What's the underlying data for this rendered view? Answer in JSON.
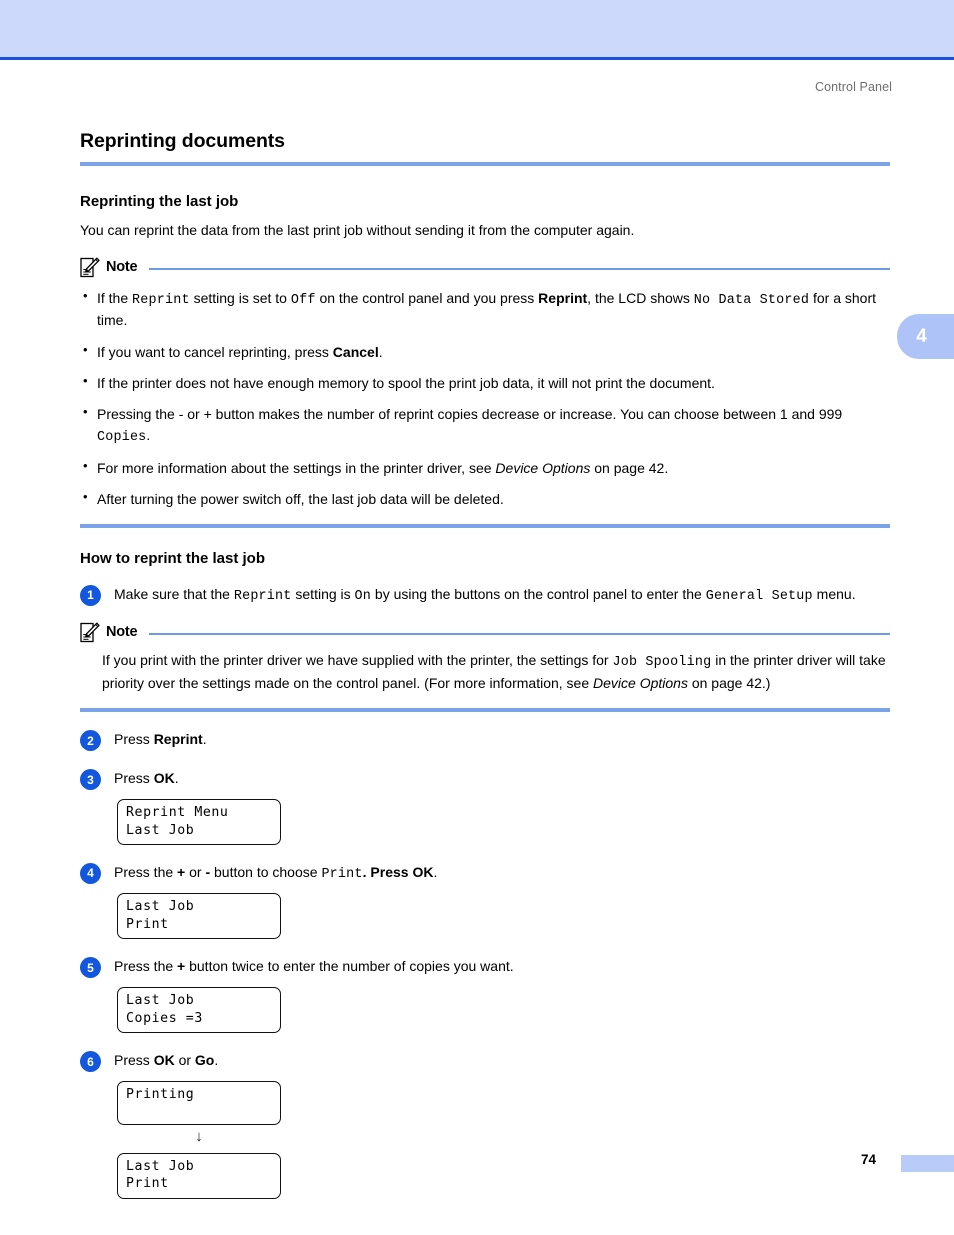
{
  "header": {
    "running_head": "Control Panel"
  },
  "chapter_tab": {
    "number": "4"
  },
  "section": {
    "title": "Reprinting documents"
  },
  "sub1": {
    "title": "Reprinting the last job",
    "intro": "You can reprint the data from the last print job without sending it from the computer again."
  },
  "note1": {
    "label": "Note",
    "icon": "note-pencil-icon",
    "bullets": [
      {
        "parts": [
          {
            "t": "If the ",
            "s": "plain"
          },
          {
            "t": "Reprint",
            "s": "mono"
          },
          {
            "t": " setting is set to ",
            "s": "plain"
          },
          {
            "t": "Off",
            "s": "mono"
          },
          {
            "t": " on the control panel and you press ",
            "s": "plain"
          },
          {
            "t": "Reprint",
            "s": "bold"
          },
          {
            "t": ", the LCD shows ",
            "s": "plain"
          },
          {
            "t": "No Data Stored",
            "s": "mono"
          },
          {
            "t": " for a short time.",
            "s": "plain"
          }
        ]
      },
      {
        "parts": [
          {
            "t": "If you want to cancel reprinting, press ",
            "s": "plain"
          },
          {
            "t": "Cancel",
            "s": "bold"
          },
          {
            "t": ".",
            "s": "plain"
          }
        ]
      },
      {
        "parts": [
          {
            "t": "If the printer does not have enough memory to spool the print job data, it will not print the document.",
            "s": "plain"
          }
        ]
      },
      {
        "parts": [
          {
            "t": "Pressing the - or + button makes the number of reprint copies decrease or increase. You can choose between 1 and 999 ",
            "s": "plain"
          },
          {
            "t": "Copies",
            "s": "mono"
          },
          {
            "t": ".",
            "s": "plain"
          }
        ]
      },
      {
        "parts": [
          {
            "t": "For more information about the settings in the printer driver, see ",
            "s": "plain"
          },
          {
            "t": "Device Options",
            "s": "italic"
          },
          {
            "t": " on page 42.",
            "s": "plain"
          }
        ]
      },
      {
        "parts": [
          {
            "t": "After turning the power switch off, the last job data will be deleted.",
            "s": "plain"
          }
        ]
      }
    ]
  },
  "sub2": {
    "title": "How to reprint the last job"
  },
  "steps": [
    {
      "number": "1",
      "parts": [
        {
          "t": "Make sure that the ",
          "s": "plain"
        },
        {
          "t": "Reprint",
          "s": "mono"
        },
        {
          "t": " setting is ",
          "s": "plain"
        },
        {
          "t": "On",
          "s": "mono"
        },
        {
          "t": " by using the buttons on the control panel to enter the ",
          "s": "plain"
        },
        {
          "t": "General Setup",
          "s": "mono"
        },
        {
          "t": " menu.",
          "s": "plain"
        }
      ]
    },
    {
      "number": "2",
      "parts": [
        {
          "t": "Press ",
          "s": "plain"
        },
        {
          "t": "Reprint",
          "s": "bold"
        },
        {
          "t": ".",
          "s": "plain"
        }
      ]
    },
    {
      "number": "3",
      "parts": [
        {
          "t": "Press ",
          "s": "plain"
        },
        {
          "t": "OK",
          "s": "bold"
        },
        {
          "t": ".",
          "s": "plain"
        }
      ]
    },
    {
      "number": "4",
      "parts": [
        {
          "t": "Press the ",
          "s": "plain"
        },
        {
          "t": "+",
          "s": "bold"
        },
        {
          "t": " or ",
          "s": "plain"
        },
        {
          "t": "-",
          "s": "bold"
        },
        {
          "t": " button to choose ",
          "s": "plain"
        },
        {
          "t": "Print",
          "s": "mono"
        },
        {
          "t": ". Press ",
          "s": "bold"
        },
        {
          "t": "OK",
          "s": "bold"
        },
        {
          "t": ".",
          "s": "plain"
        }
      ]
    },
    {
      "number": "5",
      "parts": [
        {
          "t": "Press the ",
          "s": "plain"
        },
        {
          "t": "+",
          "s": "bold"
        },
        {
          "t": " button twice to enter the number of copies you want.",
          "s": "plain"
        }
      ]
    },
    {
      "number": "6",
      "parts": [
        {
          "t": "Press ",
          "s": "plain"
        },
        {
          "t": "OK",
          "s": "bold"
        },
        {
          "t": " or ",
          "s": "plain"
        },
        {
          "t": "Go",
          "s": "bold"
        },
        {
          "t": ".",
          "s": "plain"
        }
      ]
    }
  ],
  "note2": {
    "label": "Note",
    "icon": "note-pencil-icon",
    "parts": [
      {
        "t": "If you print with the printer driver we have supplied with the printer, the settings for ",
        "s": "plain"
      },
      {
        "t": "Job Spooling",
        "s": "mono"
      },
      {
        "t": " in the printer driver will take priority over the settings made on the control panel. (For more information, see ",
        "s": "plain"
      },
      {
        "t": "Device Options",
        "s": "italic"
      },
      {
        "t": " on page 42.)",
        "s": "plain"
      }
    ]
  },
  "lcd_screens": {
    "after_step3": {
      "line1": "Reprint Menu",
      "line2": "Last Job"
    },
    "after_step4": {
      "line1": "Last Job",
      "line2": "Print"
    },
    "after_step5": {
      "line1": "Last Job",
      "line2": "Copies =3"
    },
    "after_step6_a": {
      "line1": "Printing",
      "line2": ""
    },
    "after_step6_b": {
      "line1": "Last Job",
      "line2": "Print"
    }
  },
  "flow_arrow": "↓",
  "footer": {
    "page_number": "74"
  },
  "colors": {
    "band": "#ccd9fb",
    "band_rule": "#1a53e0",
    "heading_rule": "#7ba3e8",
    "step_circle": "#1257dd",
    "chapter_tab": "#aec3f7",
    "footer_block": "#b9cbf9",
    "running_head": "#6e6e6e"
  }
}
